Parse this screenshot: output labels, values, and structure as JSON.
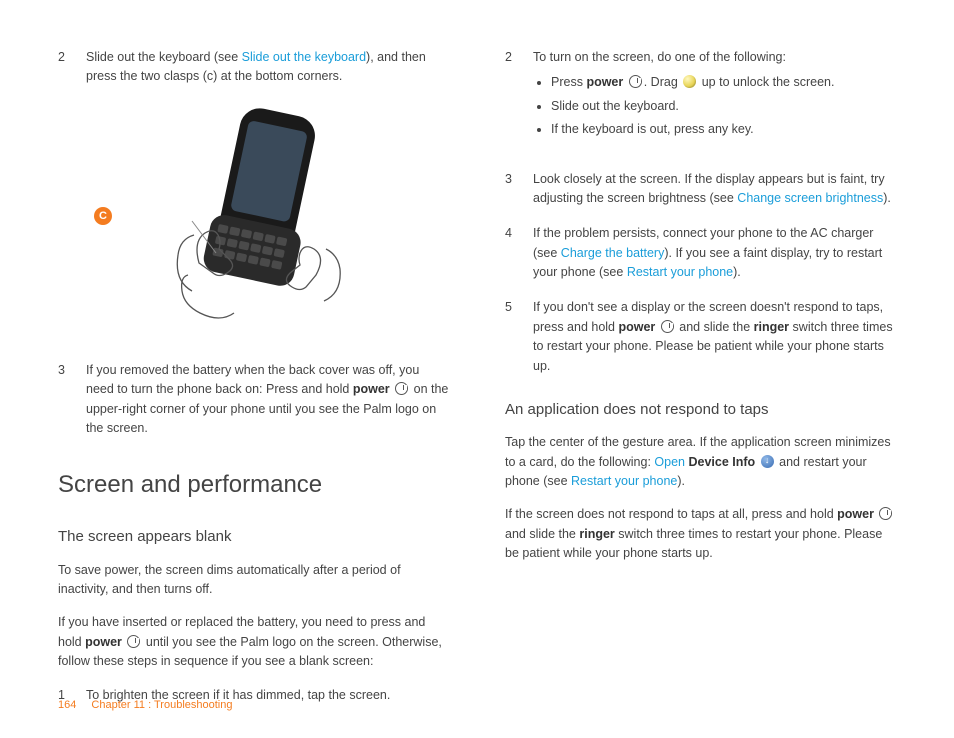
{
  "left": {
    "step2": {
      "num": "2",
      "t1": "Slide out the keyboard (see ",
      "link": "Slide out the keyboard",
      "t2": "), and then press the two clasps (c) at the bottom corners."
    },
    "callout": "C",
    "step3": {
      "num": "3",
      "t1": "If you removed the battery when the back cover was off, you need to turn the phone back on: Press and hold ",
      "b1": "power",
      "t2": " on the upper-right corner of your phone until you see the Palm logo on the screen."
    },
    "h1": "Screen and performance",
    "h2": "The screen appears blank",
    "p1": "To save power, the screen dims automatically after a period of inactivity, and then turns off.",
    "p2a": "If you have inserted or replaced the battery, you need to press and hold ",
    "p2b": "power",
    "p2c": " until you see the Palm logo on the screen. Otherwise, follow these steps in sequence if you see a blank screen:",
    "lstep1": {
      "num": "1",
      "t": "To brighten the screen if it has dimmed, tap the screen."
    }
  },
  "right": {
    "step2": {
      "num": "2",
      "t": "To turn on the screen, do one of the following:",
      "b1a": "Press ",
      "b1b": "power",
      "b1c": ". Drag ",
      "b1d": " up to unlock the screen.",
      "b2": "Slide out the keyboard.",
      "b3": "If the keyboard is out, press any key."
    },
    "step3": {
      "num": "3",
      "t1": "Look closely at the screen. If the display appears but is faint, try adjusting the screen brightness (see ",
      "link": "Change screen brightness",
      "t2": ")."
    },
    "step4": {
      "num": "4",
      "t1": "If the problem persists, connect your phone to the AC charger (see ",
      "link1": "Charge the battery",
      "t2": "). If you see a faint display, try to restart your phone (see ",
      "link2": "Restart your phone",
      "t3": ")."
    },
    "step5": {
      "num": "5",
      "t1": "If you don't see a display or the screen doesn't respond to taps, press and hold ",
      "b1": "power",
      "t2": " and slide the ",
      "b2": "ringer",
      "t3": " switch three times to restart your phone. Please be patient while your phone starts up."
    },
    "h2": "An application does not respond to taps",
    "p1a": "Tap the center of the gesture area. If the application screen minimizes to a card, do the following: ",
    "p1link1": "Open",
    "p1b": " ",
    "p1bold": "Device Info",
    "p1c": " and restart your phone (see ",
    "p1link2": "Restart your phone",
    "p1d": ").",
    "p2a": "If the screen does not respond to taps at all, press and hold ",
    "p2b": "power",
    "p2c": " and slide the ",
    "p2d": "ringer",
    "p2e": " switch three times to restart your phone. Please be patient while your phone starts up."
  },
  "footer": {
    "page": "164",
    "chapter": "Chapter 11 : Troubleshooting"
  }
}
